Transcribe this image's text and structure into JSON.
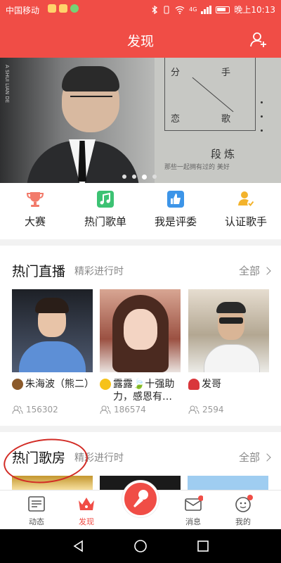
{
  "status_bar": {
    "carrier": "中国移动",
    "network": "4G",
    "time": "晚上10:13"
  },
  "header": {
    "title": "发现",
    "icon": "user-add-icon"
  },
  "banner": {
    "side_text": "A SHUI LIAN DE",
    "box_chars": [
      "分",
      "手",
      "恋",
      "歌"
    ],
    "artist": "段炼",
    "subtitle": "那些一起拥有过的 美好",
    "page_count": 4,
    "active_page": 3
  },
  "quick_actions": [
    {
      "label": "大赛",
      "icon": "trophy-icon",
      "color": "#f27b6b"
    },
    {
      "label": "热门歌单",
      "icon": "music-note-icon",
      "color": "#3cc273"
    },
    {
      "label": "我是评委",
      "icon": "thumbs-up-icon",
      "color": "#3d95e8"
    },
    {
      "label": "认证歌手",
      "icon": "verified-user-icon",
      "color": "#f3b32c"
    }
  ],
  "live_section": {
    "title": "热门直播",
    "subtitle": "精彩进行时",
    "all_label": "全部",
    "items": [
      {
        "name": "朱海波（熊二）",
        "emoji": "bear-emoji",
        "viewers": "156302"
      },
      {
        "name": "露露🍃十强助力，感恩有…",
        "emoji": "sun-emoji",
        "viewers": "186574"
      },
      {
        "name": "发哥",
        "emoji": "mushroom-emoji",
        "viewers": "2594"
      }
    ]
  },
  "rooms_section": {
    "title": "热门歌房",
    "subtitle": "精彩进行时",
    "all_label": "全部"
  },
  "tab_bar": {
    "tabs": [
      {
        "label": "动态",
        "icon": "feed-icon"
      },
      {
        "label": "发现",
        "icon": "crown-icon",
        "active": true
      },
      {
        "label": "消息",
        "icon": "mail-icon",
        "badge": true
      },
      {
        "label": "我的",
        "icon": "profile-icon",
        "badge": true
      }
    ],
    "center_icon": "microphone-icon"
  },
  "colors": {
    "brand": "#f04d46",
    "annotation_ring": "#d22b25"
  }
}
